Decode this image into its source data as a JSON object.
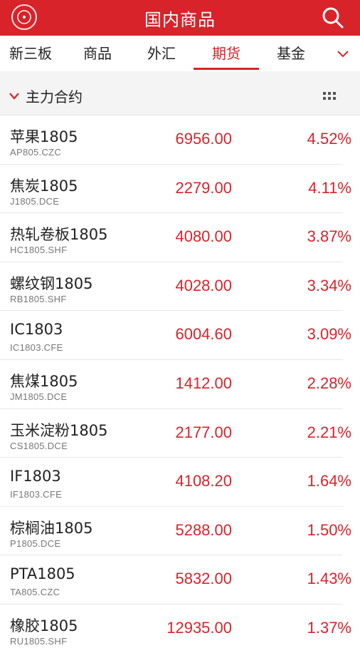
{
  "colors": {
    "accent": "#d8232a",
    "up": "#d8232a"
  },
  "header": {
    "title": "国内商品",
    "logo_icon": "app-logo-icon",
    "search_icon": "search-icon"
  },
  "tabs": [
    {
      "label": "新三板",
      "active": false
    },
    {
      "label": "商品",
      "active": false
    },
    {
      "label": "外汇",
      "active": false
    },
    {
      "label": "期货",
      "active": true
    },
    {
      "label": "基金",
      "active": false
    }
  ],
  "section": {
    "label": "主力合约"
  },
  "rows": [
    {
      "name": "苹果1805",
      "code": "AP805.CZC",
      "price": "6956.00",
      "change": "4.52%"
    },
    {
      "name": "焦炭1805",
      "code": "J1805.DCE",
      "price": "2279.00",
      "change": "4.11%"
    },
    {
      "name": "热轧卷板1805",
      "code": "HC1805.SHF",
      "price": "4080.00",
      "change": "3.87%"
    },
    {
      "name": "螺纹钢1805",
      "code": "RB1805.SHF",
      "price": "4028.00",
      "change": "3.34%"
    },
    {
      "name": "IC1803",
      "code": "IC1803.CFE",
      "price": "6004.60",
      "change": "3.09%"
    },
    {
      "name": "焦煤1805",
      "code": "JM1805.DCE",
      "price": "1412.00",
      "change": "2.28%"
    },
    {
      "name": "玉米淀粉1805",
      "code": "CS1805.DCE",
      "price": "2177.00",
      "change": "2.21%"
    },
    {
      "name": "IF1803",
      "code": "IF1803.CFE",
      "price": "4108.20",
      "change": "1.64%"
    },
    {
      "name": "棕榈油1805",
      "code": "P1805.DCE",
      "price": "5288.00",
      "change": "1.50%"
    },
    {
      "name": "PTA1805",
      "code": "TA805.CZC",
      "price": "5832.00",
      "change": "1.43%"
    },
    {
      "name": "橡胶1805",
      "code": "RU1805.SHF",
      "price": "12935.00",
      "change": "1.37%"
    }
  ]
}
